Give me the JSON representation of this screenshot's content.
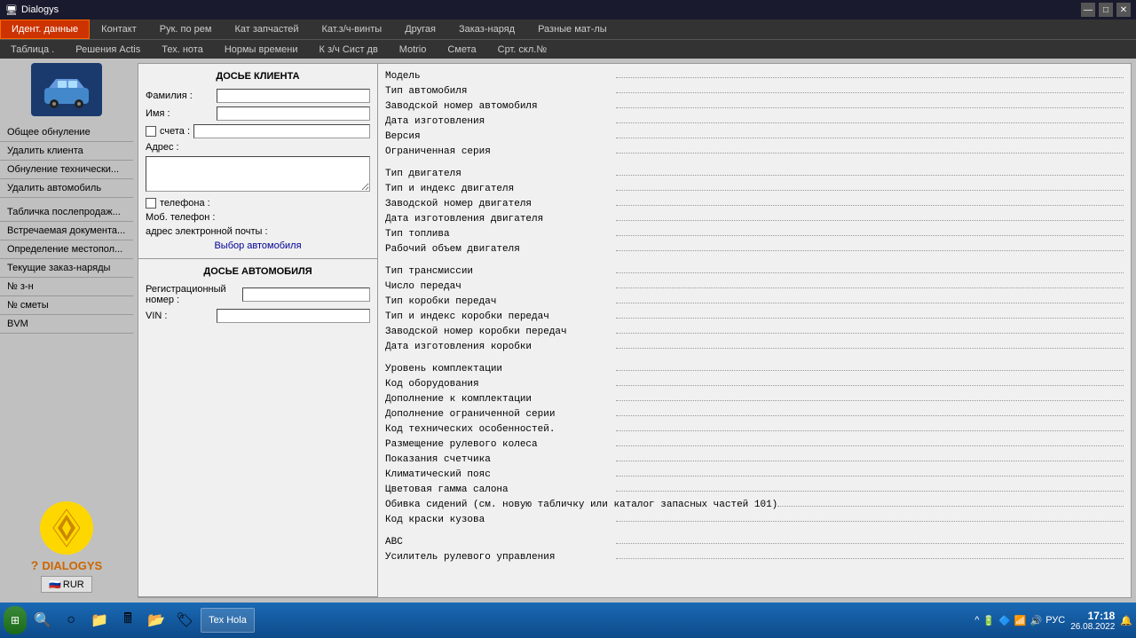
{
  "titlebar": {
    "title": "Dialogys",
    "btn_minimize": "—",
    "btn_maximize": "□",
    "btn_close": "✕"
  },
  "menubar1": {
    "items": [
      {
        "label": "Идент. данные",
        "active": true
      },
      {
        "label": "Контакт",
        "active": false
      },
      {
        "label": "Рук. по рем",
        "active": false
      },
      {
        "label": "Кат запчастей",
        "active": false
      },
      {
        "label": "Кат.з/ч-винты",
        "active": false
      },
      {
        "label": "Другая",
        "active": false
      },
      {
        "label": "Заказ-наряд",
        "active": false
      },
      {
        "label": "Разные мат-лы",
        "active": false
      }
    ]
  },
  "menubar2": {
    "items": [
      {
        "label": "Таблица ."
      },
      {
        "label": "Решения Actis"
      },
      {
        "label": "Тех. нота"
      },
      {
        "label": "Нормы времени"
      },
      {
        "label": "К з/ч Сист дв"
      },
      {
        "label": "Motrio"
      },
      {
        "label": "Смета"
      },
      {
        "label": "Срт. скл.№"
      }
    ]
  },
  "sidebar": {
    "menu_items": [
      {
        "label": "Общее обнуление",
        "section_gap": false
      },
      {
        "label": "Удалить клиента",
        "section_gap": false
      },
      {
        "label": "Обнуление технически...",
        "section_gap": false
      },
      {
        "label": "Удалить автомобиль",
        "section_gap": false
      },
      {
        "label": "Табличка послепродаж...",
        "section_gap": true
      },
      {
        "label": "Встречаемая документа...",
        "section_gap": false
      },
      {
        "label": "Определение местопол...",
        "section_gap": false
      },
      {
        "label": "Текущие заказ-наряды",
        "section_gap": false
      },
      {
        "label": "№ з-н",
        "section_gap": false
      },
      {
        "label": "№ сметы",
        "section_gap": false
      },
      {
        "label": "BVM",
        "section_gap": false
      }
    ],
    "currency": "RUR"
  },
  "client_dossier": {
    "title": "ДОСЬЕ КЛИЕНТА",
    "family_label": "Фамилия :",
    "name_label": "Имя :",
    "account_label": "счета :",
    "address_label": "Адрес :",
    "phone_label": "телефона :",
    "mobile_label": "Моб. телефон :",
    "email_label": "адрес электронной почты :",
    "vehicle_selection": "Выбор автомобиля"
  },
  "vehicle_dossier": {
    "title": "ДОСЬЕ АВТОМОБИЛЯ",
    "reg_label": "Регистрационный номер :",
    "vin_label": "VIN :"
  },
  "vehicle_info": {
    "lines": [
      "Модель",
      "Тип автомобиля",
      "Заводской номер автомобиля",
      "Дата изготовления",
      "Версия",
      "Ограниченная серия"
    ],
    "engine_lines": [
      "Тип двигателя",
      "Тип и индекс двигателя",
      "Заводской номер двигателя",
      "Дата изготовления двигателя",
      "Тип топлива",
      "Рабочий объем двигателя"
    ],
    "transmission_lines": [
      "Тип трансмиссии",
      "Число передач",
      "Тип коробки передач",
      "Тип и индекс коробки передач",
      "Заводской номер коробки передач",
      "Дата изготовления коробки"
    ],
    "equipment_lines": [
      "Уровень комплектации",
      "Код оборудования",
      "Дополнение к комплектации",
      "Дополнение ограниченной серии",
      "Код технических особенностей.",
      "Размещение рулевого колеса",
      "Показания счетчика",
      "Климатический пояс",
      "Цветовая гамма салона",
      "Обивка сидений (см. новую табличку или каталог запасных частей 101)",
      "Код краски кузова"
    ],
    "systems_lines": [
      "АВС",
      "Усилитель рулевого управления"
    ]
  },
  "taskbar": {
    "app_label": "Tex Hola",
    "time": "17:18",
    "date": "26.08.2022",
    "lang": "РУС"
  }
}
